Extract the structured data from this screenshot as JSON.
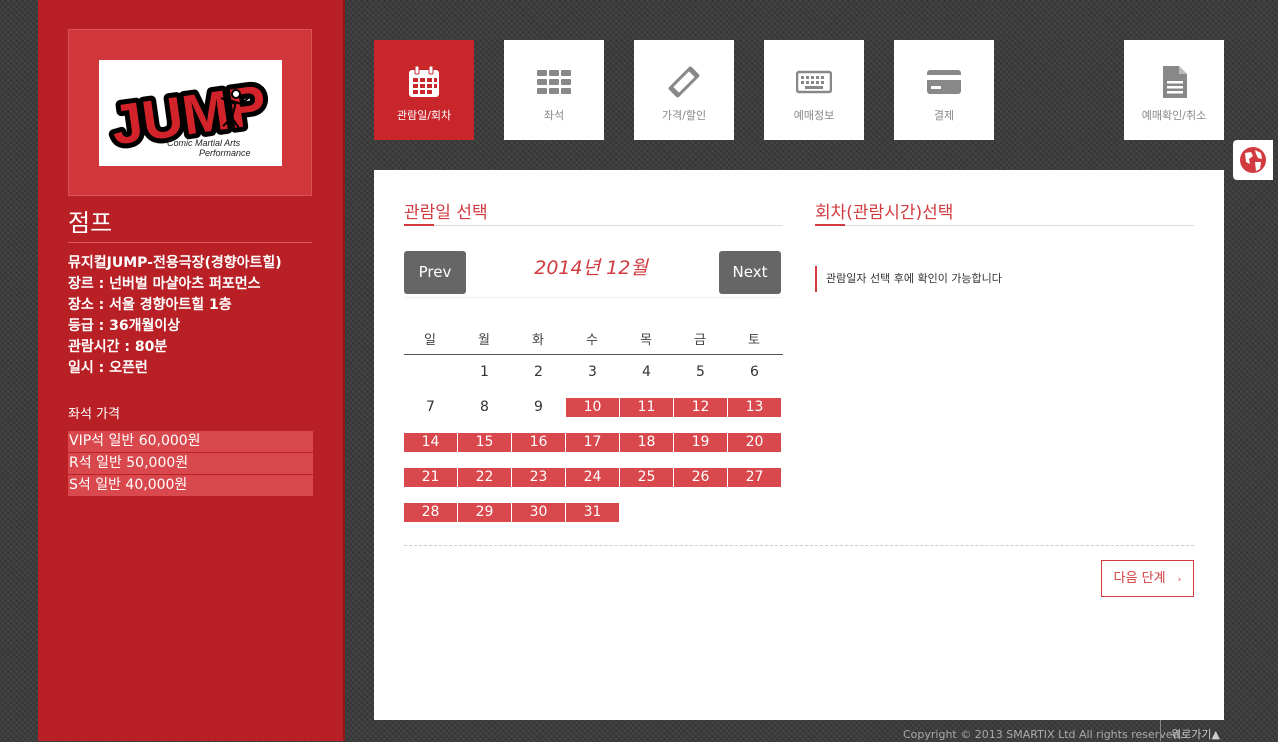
{
  "sidebar": {
    "logo": {
      "brand": "JUMP",
      "subtitle_line1": "Comic Martial Arts",
      "subtitle_line2": "Performance"
    },
    "title": "점프",
    "info": [
      "뮤지컬JUMP-전용극장(경향아트힐)",
      "장르 : 넌버벌 마샬아츠 퍼포먼스",
      "장소 : 서울 경향아트힐 1층",
      "등급 : 36개월이상",
      "관람시간 : 80분",
      "일시 : 오픈런"
    ],
    "price_title": "좌석 가격",
    "prices": [
      "VIP석 일반 60,000원",
      "R석 일반 50,000원",
      "S석 일반 40,000원"
    ]
  },
  "tabs": [
    {
      "label": "관람일/회차",
      "icon": "calendar-icon",
      "active": true
    },
    {
      "label": "좌석",
      "icon": "seat-grid-icon",
      "active": false
    },
    {
      "label": "가격/할인",
      "icon": "ticket-icon",
      "active": false
    },
    {
      "label": "예매정보",
      "icon": "keyboard-icon",
      "active": false
    },
    {
      "label": "결제",
      "icon": "credit-card-icon",
      "active": false
    },
    {
      "label": "예매확인/취소",
      "icon": "document-icon",
      "active": false
    }
  ],
  "date_section": {
    "title": "관람일 선택",
    "prev_label": "Prev",
    "next_label": "Next",
    "month_label": "2014년 12월",
    "weekdays": [
      "일",
      "월",
      "화",
      "수",
      "목",
      "금",
      "토"
    ],
    "weeks": [
      [
        {
          "d": ""
        },
        {
          "d": "1"
        },
        {
          "d": "2"
        },
        {
          "d": "3"
        },
        {
          "d": "4"
        },
        {
          "d": "5"
        },
        {
          "d": "6"
        }
      ],
      [
        {
          "d": "7"
        },
        {
          "d": "8"
        },
        {
          "d": "9"
        },
        {
          "d": "10",
          "available": true
        },
        {
          "d": "11",
          "available": true
        },
        {
          "d": "12",
          "available": true
        },
        {
          "d": "13",
          "available": true
        }
      ],
      [
        {
          "d": "14",
          "available": true
        },
        {
          "d": "15",
          "available": true
        },
        {
          "d": "16",
          "available": true
        },
        {
          "d": "17",
          "available": true
        },
        {
          "d": "18",
          "available": true
        },
        {
          "d": "19",
          "available": true
        },
        {
          "d": "20",
          "available": true
        }
      ],
      [
        {
          "d": "21",
          "available": true
        },
        {
          "d": "22",
          "available": true
        },
        {
          "d": "23",
          "available": true
        },
        {
          "d": "24",
          "available": true
        },
        {
          "d": "25",
          "available": true
        },
        {
          "d": "26",
          "available": true
        },
        {
          "d": "27",
          "available": true
        }
      ],
      [
        {
          "d": "28",
          "available": true
        },
        {
          "d": "29",
          "available": true
        },
        {
          "d": "30",
          "available": true
        },
        {
          "d": "31",
          "available": true
        }
      ]
    ]
  },
  "time_section": {
    "title": "회차(관람시간)선택",
    "notice": "관람일자 선택 후에 확인이 가능합니다"
  },
  "next_step_label": "다음 단계",
  "footer": {
    "copyright": "Copyright © 2013 SMARTIX Ltd All rights reserved.",
    "to_top": "위로가기"
  },
  "colors": {
    "accent": "#d13b3f",
    "sidebar": "#b92025",
    "available_day": "#d9484c"
  }
}
